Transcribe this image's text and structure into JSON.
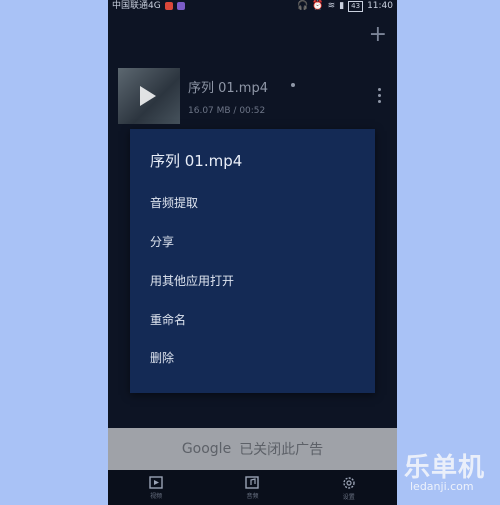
{
  "statusbar": {
    "carrier": "中国联通4G",
    "battery": "43",
    "time": "11:40"
  },
  "appbar": {
    "add_label": "+"
  },
  "video": {
    "title": "序列 01.mp4",
    "meta": "16.07 MB / 00:52"
  },
  "dialog": {
    "title": "序列 01.mp4",
    "items": [
      "音频提取",
      "分享",
      "用其他应用打开",
      "重命名",
      "删除"
    ]
  },
  "ad": {
    "brand": "Google",
    "text": "已关闭此广告"
  },
  "bottomnav": {
    "items": [
      {
        "label": "视频",
        "icon": "video-icon"
      },
      {
        "label": "音频",
        "icon": "audio-icon"
      },
      {
        "label": "设置",
        "icon": "gear-icon"
      }
    ]
  },
  "watermark": {
    "text": "乐单机",
    "url": "ledanji.com"
  }
}
